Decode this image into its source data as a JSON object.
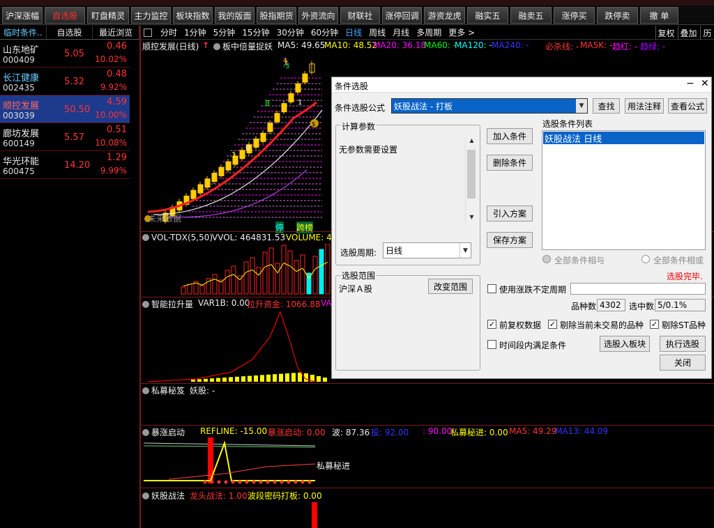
{
  "toolbar": {
    "buttons": [
      {
        "label": "沪深涨幅",
        "active": false
      },
      {
        "label": "自选股",
        "active": true
      },
      {
        "label": "盯盘精灵",
        "active": false
      },
      {
        "label": "主力监控",
        "active": false
      },
      {
        "label": "板块指数",
        "active": false
      },
      {
        "label": "我的版面",
        "active": false
      },
      {
        "label": "股指期货",
        "active": false
      },
      {
        "label": "外资流向",
        "active": false
      },
      {
        "label": "财联社",
        "active": false
      },
      {
        "label": "涨停回调",
        "active": false
      },
      {
        "label": "游资龙虎",
        "active": false
      },
      {
        "label": "融实五",
        "active": false
      },
      {
        "label": "融卖五",
        "active": false
      },
      {
        "label": "涨停买",
        "active": false
      },
      {
        "label": "跌停卖",
        "active": false
      },
      {
        "label": "撤 单",
        "active": false
      }
    ]
  },
  "left_tabs": [
    "临时条件..",
    "自选股",
    "最近浏览"
  ],
  "stocks": [
    {
      "name": "山东地矿",
      "code": "000409",
      "price": "5.05",
      "change": "0.46",
      "pct": "10.02%",
      "selected": false
    },
    {
      "name": "长江健康",
      "code": "002435",
      "price": "5.32",
      "change": "0.48",
      "pct": "9.92%",
      "selected": false
    },
    {
      "name": "顺控发展",
      "code": "003039",
      "price": "50.50",
      "change": "4.59",
      "pct": "10.00%",
      "selected": true
    },
    {
      "name": "廊坊发展",
      "code": "600149",
      "price": "5.57",
      "change": "0.51",
      "pct": "10.08%",
      "selected": false
    },
    {
      "name": "华光环能",
      "code": "600475",
      "price": "14.20",
      "change": "1.29",
      "pct": "9.99%",
      "selected": false
    }
  ],
  "periods": [
    {
      "label": "分时",
      "active": false
    },
    {
      "label": "1分钟",
      "active": false
    },
    {
      "label": "5分钟",
      "active": false
    },
    {
      "label": "15分钟",
      "active": false
    },
    {
      "label": "30分钟",
      "active": false
    },
    {
      "label": "60分钟",
      "active": false
    },
    {
      "label": "日线",
      "active": true
    },
    {
      "label": "周线",
      "active": false
    },
    {
      "label": "月线",
      "active": false
    },
    {
      "label": "多周期",
      "active": false
    },
    {
      "label": "更多 >",
      "active": false
    }
  ],
  "right_tabs": [
    "复权",
    "叠加",
    "历"
  ],
  "main_chart": {
    "title": "顺控发展(日线)",
    "indicator": "板中倍量捉妖",
    "ma5": "MA5: 49.65",
    "ma10": "MA10: 48.52",
    "ma20": "MA20: 36.18",
    "ma60": "MA60: -",
    "ma120": "MA120: -",
    "ma240": "MA240: -",
    "bisha": "必杀线: -",
    "ma5k": "MA5K: -",
    "qushi": "趋红: -",
    "qulv": "趋绿: -",
    "future": "未来数据",
    "tag_ting": "停",
    "tag_kuaban": "跨榜",
    "markers": [
      "5",
      "1",
      "8",
      "1",
      "0"
    ],
    "colors": {
      "ma_red": "#ff2020",
      "ma_white": "#e8e8e8",
      "ma_violet": "#b040e0",
      "candle": "#ffcc00"
    }
  },
  "vol_panel": {
    "name": "VOL-TDX(5,50)",
    "vvol": "VVOL: 464831.53",
    "volume": "VOLUME: 46"
  },
  "lift_panel": {
    "name": "智能拉升量",
    "var1b": "VAR1B: 0.00",
    "funds": "拉升资金: 1066.88",
    "extra": "VA"
  },
  "private_panel": {
    "name": "私募秘笈",
    "sub": "妖股: -"
  },
  "surge_panel": {
    "name": "暴涨启动",
    "refline": "REFLINE: -15.00",
    "start": "暴涨启动: 0.00",
    "wave": "波: 87.36",
    "buy": "投: 92.00",
    "ninety": ": 90.00",
    "simu": "私募秘进: 0.00",
    "ma5": "MA5: 49.29",
    "ma13": "MA13: 44.09",
    "label": "私募秘进"
  },
  "demon_panel": {
    "name": "妖股战法",
    "dragon": "龙头战法: 1.00",
    "wave": "波段密码打板: 0.00"
  },
  "dialog": {
    "title": "条件选股",
    "formula_label": "条件选股公式",
    "formula_value": "妖股战法      - 打板",
    "btn_find": "查找",
    "btn_usage": "用法注释",
    "btn_view": "查看公式",
    "params_group": "计算参数",
    "params_text": "无参数需要设置",
    "period_label": "选股周期:",
    "period_value": "日线",
    "scope_group": "选股范围",
    "scope_value": "沪深Ａ股",
    "btn_change_scope": "改变范围",
    "btn_add": "加入条件",
    "btn_delete": "删除条件",
    "btn_import": "引入方案",
    "btn_save": "保存方案",
    "list_label": "选股条件列表",
    "list_items": [
      "妖股战法  日线"
    ],
    "radio_and": "全部条件相与",
    "radio_or": "全部条件相或",
    "status": "选股完毕.",
    "use_unfixed": "使用涨跌不定周期",
    "count_label": "品种数",
    "count_value": "4302",
    "selected_label": "选中数",
    "selected_value": "5/0.1%",
    "chk_prefq": "前复权数据",
    "chk_exclude_untrade": "剔除当前未交易的品种",
    "chk_exclude_st": "剔除ST品种",
    "chk_period": "时间段内满足条件",
    "btn_to_block": "选股入板块",
    "btn_execute": "执行选股",
    "btn_close": "关闭"
  }
}
